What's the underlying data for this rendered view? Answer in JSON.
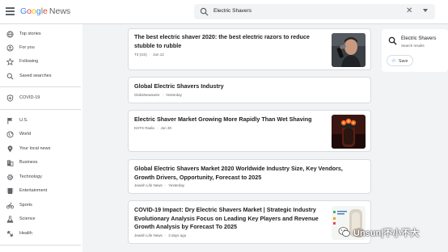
{
  "header": {
    "logo_google": [
      "G",
      "o",
      "o",
      "g",
      "l",
      "e"
    ],
    "logo_news": "News",
    "search_query": "Electric Shavers"
  },
  "sidebar": {
    "items": [
      {
        "label": "Top stories",
        "icon": "globe-icon"
      },
      {
        "label": "For you",
        "icon": "person-icon"
      },
      {
        "label": "Following",
        "icon": "star-icon"
      },
      {
        "label": "Saved searches",
        "icon": "search-icon"
      },
      {
        "label": "COVID-19",
        "icon": "shield-icon"
      },
      {
        "label": "U.S.",
        "icon": "flag-icon"
      },
      {
        "label": "World",
        "icon": "globe-icon"
      },
      {
        "label": "Your local news",
        "icon": "location-pin-icon"
      },
      {
        "label": "Business",
        "icon": "building-icon"
      },
      {
        "label": "Technology",
        "icon": "gear-icon"
      },
      {
        "label": "Entertainment",
        "icon": "film-icon"
      },
      {
        "label": "Sports",
        "icon": "bike-icon"
      },
      {
        "label": "Science",
        "icon": "flask-icon"
      },
      {
        "label": "Health",
        "icon": "dumbbell-icon"
      }
    ]
  },
  "articles": [
    {
      "title": "The best electric shaver 2020: the best electric razors to reduce stubble to rubble",
      "source": "T3 (US)",
      "time": "Jun 12",
      "has_thumb": true
    },
    {
      "title": "Global Electric Shavers Industry",
      "source": "GlobeNewswire",
      "time": "Yesterday",
      "has_thumb": false
    },
    {
      "title": "Electric Shaver Market Growing More Rapidly Than Wet Shaving",
      "source": "KHTS Radio",
      "time": "Jun 30",
      "has_thumb": true
    },
    {
      "title": "Global Electric Shavers Market 2020 Worldwide Industry Size, Key Vendors, Growth Drivers, Opportunity, Forecast to 2025",
      "source": "Jewish Life News",
      "time": "Yesterday",
      "has_thumb": false
    },
    {
      "title": "COVID-19 Impact: Dry Electric Shavers Market | Strategic Industry Evolutionary Analysis Focus on Leading Key Players and Revenue Growth Analysis by Forecast To 2025",
      "source": "Jewish Life News",
      "time": "3 days ago",
      "has_thumb": true
    }
  ],
  "right_panel": {
    "title": "Electric Shavers",
    "subtitle": "Search results",
    "save_label": "Save"
  },
  "watermark": {
    "text": "Unsun|不小不大"
  },
  "colors": {
    "google_blue": "#4285f4",
    "google_red": "#ea4335",
    "google_yellow": "#fbbc05",
    "google_green": "#34a853",
    "link_blue": "#1a73e8"
  }
}
